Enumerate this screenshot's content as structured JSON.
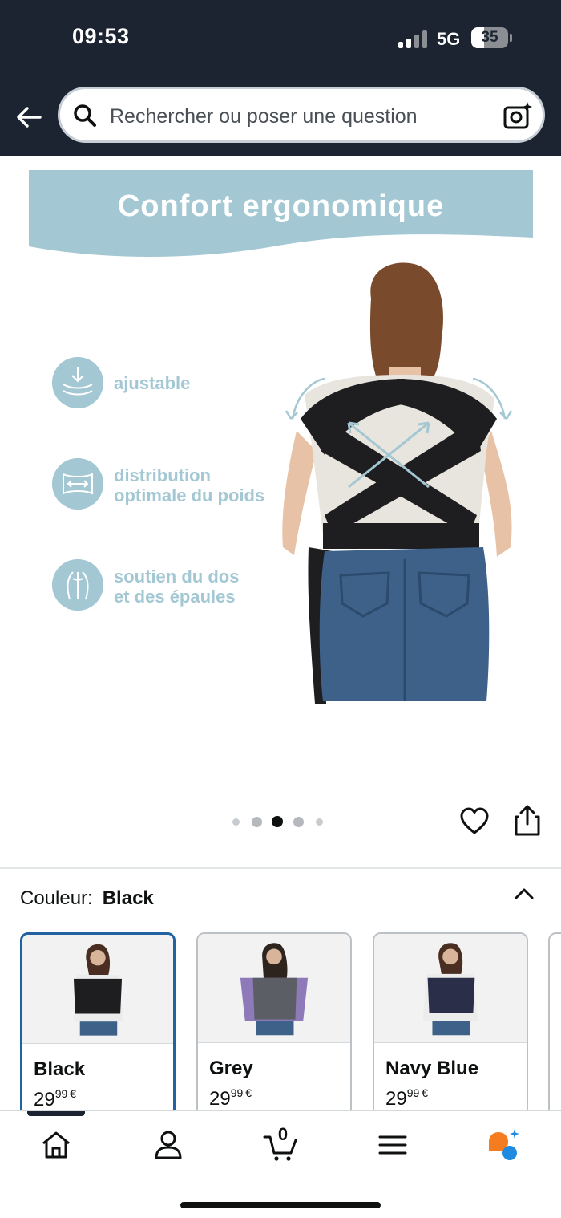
{
  "status_bar": {
    "time": "09:53",
    "network": "5G",
    "battery": "35"
  },
  "search": {
    "placeholder": "Rechercher ou poser une question"
  },
  "hero": {
    "title": "Confort ergonomique",
    "features": [
      {
        "line1": "ajustable",
        "line2": "",
        "icon": "compress-arrows-icon"
      },
      {
        "line1": "distribution",
        "line2": "optimale du poids",
        "icon": "weight-distribution-icon"
      },
      {
        "line1": "soutien du dos",
        "line2": "et des épaules",
        "icon": "back-support-icon"
      }
    ],
    "carousel": {
      "total": 5,
      "active_index": 2
    }
  },
  "color_selector": {
    "label": "Couleur:",
    "value": "Black"
  },
  "swatches": [
    {
      "name": "Black",
      "price_whole": "29",
      "price_fraction": "99",
      "currency": "€",
      "selected": true,
      "wrap_color": "#1e1e20"
    },
    {
      "name": "Grey",
      "price_whole": "29",
      "price_fraction": "99",
      "currency": "€",
      "selected": false,
      "wrap_color": "#5c5e66"
    },
    {
      "name": "Navy Blue",
      "price_whole": "29",
      "price_fraction": "99",
      "currency": "€",
      "selected": false,
      "wrap_color": "#2a2e48"
    }
  ],
  "bottom_nav": {
    "cart_count": "0",
    "items": [
      "home-icon",
      "account-icon",
      "cart-icon",
      "menu-icon",
      "assistant-icon"
    ]
  },
  "colors": {
    "header_bg": "#1b2430",
    "banner": "#a3c8d3",
    "selected_border": "#2162a1",
    "assistant_orange": "#f57c1f",
    "assistant_blue": "#1f8ae0"
  }
}
